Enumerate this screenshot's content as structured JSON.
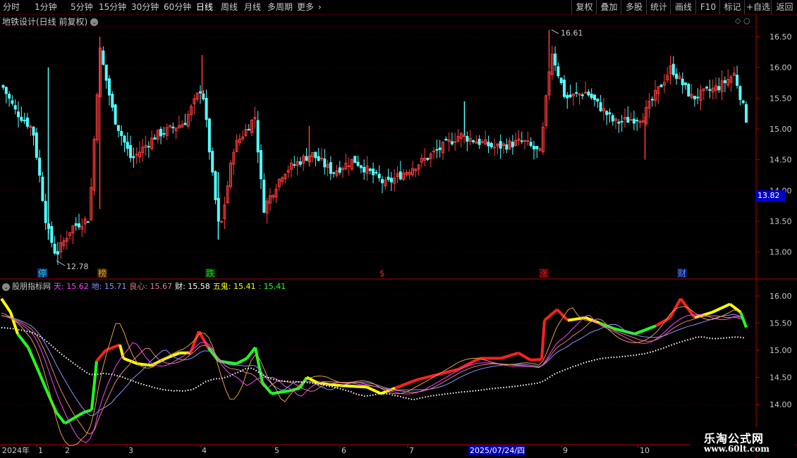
{
  "toolbar": {
    "timeframes": [
      "分时",
      "1分钟",
      "5分钟",
      "15分钟",
      "30分钟",
      "60分钟",
      "日线",
      "周线",
      "月线",
      "多周期",
      "更多"
    ],
    "active": "日线",
    "right_buttons": [
      "复权",
      "叠加",
      "多股",
      "统计",
      "画线",
      "F10",
      "标记",
      "+自选",
      "返回"
    ]
  },
  "main_panel": {
    "title": "地铁设计(日线 前复权)",
    "price_axis": [
      "16.50",
      "16.00",
      "15.50",
      "15.00",
      "14.50",
      "14.00",
      "13.50",
      "13.00"
    ],
    "current_price": "13.82",
    "high_label": "16.61",
    "low_label": "12.78",
    "markers": [
      {
        "text": "停",
        "color": "#2ec4d6",
        "bg": "#0a3a7a"
      },
      {
        "text": "榜",
        "color": "#e0a030",
        "bg": "#3a2a00"
      },
      {
        "text": "跌",
        "color": "#20d020",
        "bg": "#003a00"
      },
      {
        "text": "$",
        "color": "#e02020",
        "bg": "#000"
      },
      {
        "text": "涨",
        "color": "#e02020",
        "bg": "#3a0000"
      },
      {
        "text": "财",
        "color": "#5a8aff",
        "bg": "#0a1a5a"
      }
    ],
    "up_color": "#ff3c3c",
    "down_color": "#54ffff"
  },
  "indicator_panel": {
    "name": "股朋指标网",
    "values": [
      {
        "label": "天: 15.62",
        "color": "#ff40ff"
      },
      {
        "label": "地: 15.71",
        "color": "#9090ff"
      },
      {
        "label": "良心: 15.67",
        "color": "#e08080"
      },
      {
        "label": "财: 15.58",
        "color": "#ffffff"
      },
      {
        "label": "五鬼: 15.41",
        "color": "#ffff00"
      },
      {
        "label": ": 15.41",
        "color": "#20ff20"
      }
    ],
    "price_axis": [
      "16.00",
      "15.50",
      "15.00",
      "14.50",
      "14.00"
    ]
  },
  "time_axis": {
    "labels": [
      "2024年",
      "1",
      "2",
      "3",
      "4",
      "5",
      "6",
      "7",
      "9",
      "10"
    ],
    "crosshair_date": "2025/07/24/四"
  },
  "watermark": {
    "line1": "乐淘公式网",
    "line2": "www.60lt.com"
  }
}
